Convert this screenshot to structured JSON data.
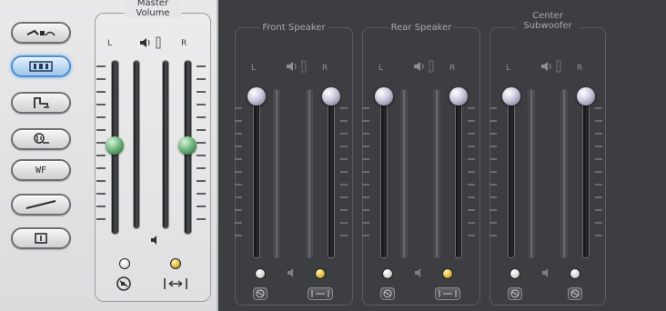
{
  "master": {
    "title": [
      "Master",
      "Volume"
    ],
    "left_label": "L",
    "right_label": "R"
  },
  "mode_buttons": [
    {
      "name": "mode-button-1",
      "icon": "analog-out-icon",
      "active": false
    },
    {
      "name": "mode-button-2",
      "icon": "io-icon",
      "active": true
    },
    {
      "name": "mode-button-3",
      "icon": "effects-icon",
      "active": false
    },
    {
      "name": "mode-button-4",
      "icon": "eq-icon",
      "active": false
    },
    {
      "name": "mode-button-5",
      "icon": "text-icon",
      "label": "WF"
    },
    {
      "name": "mode-button-6",
      "icon": "line-icon",
      "active": false
    },
    {
      "name": "mode-button-7",
      "icon": "stop-icon",
      "active": false
    }
  ],
  "groups": [
    {
      "title": [
        "Front Speaker"
      ],
      "left_label": "L",
      "right_label": "R"
    },
    {
      "title": [
        "Rear Speaker"
      ],
      "left_label": "L",
      "right_label": "R"
    },
    {
      "title": [
        "Center",
        "Subwoofer"
      ],
      "left_label": "L",
      "right_label": "R"
    }
  ],
  "colors": {
    "light_panel": "#e6e6e8",
    "dark_panel": "#3d3e41",
    "accent_active": "#6fb1ee",
    "knob_green": "#7fc08a",
    "knob_grey": "#cfd0e2",
    "led_on": "#e1b93b"
  }
}
